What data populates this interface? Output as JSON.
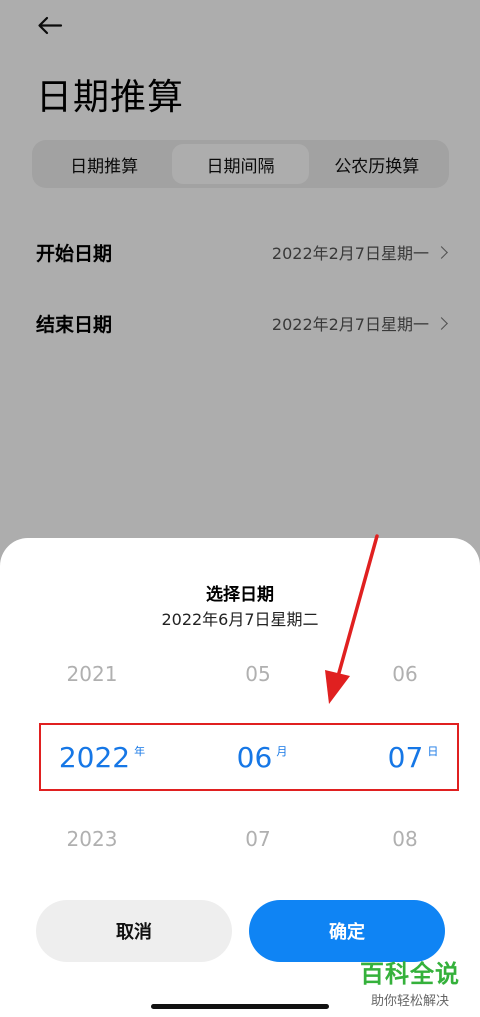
{
  "header": {
    "title": "日期推算"
  },
  "tabs": [
    {
      "label": "日期推算"
    },
    {
      "label": "日期间隔"
    },
    {
      "label": "公农历换算"
    }
  ],
  "rows": [
    {
      "label": "开始日期",
      "value": "2022年2月7日星期一"
    },
    {
      "label": "结束日期",
      "value": "2022年2月7日星期一"
    }
  ],
  "picker": {
    "title": "选择日期",
    "subtitle": "2022年6月7日星期二",
    "above": {
      "year": "2021",
      "month": "05",
      "day": "06"
    },
    "selected": {
      "year": "2022",
      "year_unit": "年",
      "month": "06",
      "month_unit": "月",
      "day": "07",
      "day_unit": "日"
    },
    "below": {
      "year": "2023",
      "month": "07",
      "day": "08"
    },
    "cancel_label": "取消",
    "confirm_label": "确定"
  },
  "watermark": {
    "main": "百科全说",
    "sub": "助你轻松解决"
  },
  "colors": {
    "accent": "#0f84f4",
    "selected_text": "#1677e6",
    "highlight_box": "#e02020",
    "annotation_arrow": "#e02020",
    "watermark": "#35b13b"
  },
  "icons": {
    "back": "arrow-left-icon",
    "chevron": "chevron-right-icon"
  }
}
